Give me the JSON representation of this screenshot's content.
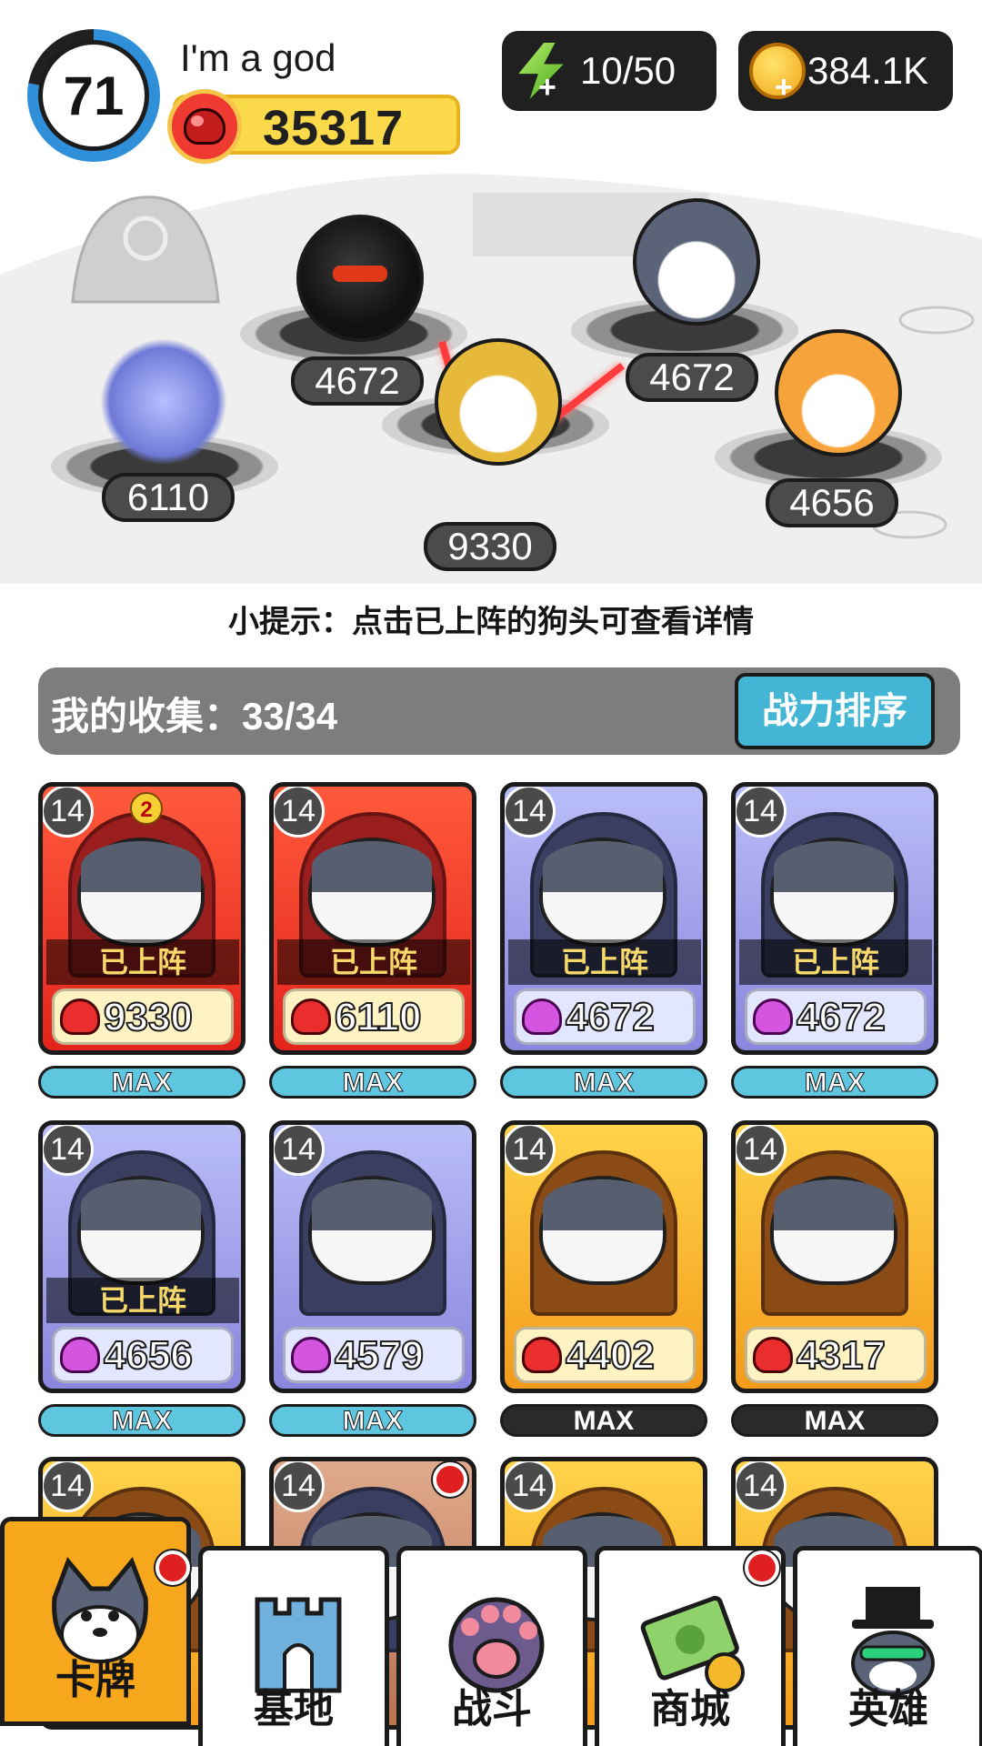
{
  "player": {
    "level": "71",
    "name": "I'm a god",
    "power": "35317"
  },
  "resources": {
    "energy": "10/50",
    "coins": "384.1K"
  },
  "arena": {
    "positions": [
      {
        "id": "left",
        "power": "6110"
      },
      {
        "id": "top-left",
        "power": "4672"
      },
      {
        "id": "center",
        "power": "9330"
      },
      {
        "id": "top-right",
        "power": "4672"
      },
      {
        "id": "right",
        "power": "4656"
      }
    ]
  },
  "tip": "小提示：点击已上阵的狗头可查看详情",
  "collection": {
    "label": "我的收集：33/34",
    "sort_button": "战力排序"
  },
  "cards": [
    {
      "level": "14",
      "stars": "2",
      "deployed": "已上阵",
      "power": "9330",
      "max": "MAX",
      "style": "red"
    },
    {
      "level": "14",
      "deployed": "已上阵",
      "power": "6110",
      "max": "MAX",
      "style": "red"
    },
    {
      "level": "14",
      "deployed": "已上阵",
      "power": "4672",
      "max": "MAX",
      "style": "purple"
    },
    {
      "level": "14",
      "deployed": "已上阵",
      "power": "4672",
      "max": "MAX",
      "style": "purple"
    },
    {
      "level": "14",
      "deployed": "已上阵",
      "power": "4656",
      "max": "MAX",
      "style": "purple"
    },
    {
      "level": "14",
      "power": "4579",
      "max": "MAX",
      "style": "purple"
    },
    {
      "level": "14",
      "power": "4402",
      "max": "MAX",
      "style": "gold"
    },
    {
      "level": "14",
      "power": "4317",
      "max": "MAX",
      "style": "gold"
    },
    {
      "level": "14",
      "style": "gold"
    },
    {
      "level": "14",
      "style": "bronze"
    },
    {
      "level": "14",
      "style": "gold"
    },
    {
      "level": "14",
      "style": "gold"
    }
  ],
  "nav": {
    "tabs": [
      {
        "label": "卡牌",
        "icon": "dog-card-icon",
        "active": true
      },
      {
        "label": "基地",
        "icon": "castle-icon"
      },
      {
        "label": "战斗",
        "icon": "paw-icon"
      },
      {
        "label": "商城",
        "icon": "money-icon"
      },
      {
        "label": "英雄",
        "icon": "hero-dog-icon"
      }
    ]
  },
  "colors": {
    "level_ring": "#2f8fd8",
    "power_pill": "#fad94a",
    "sort_button": "#43b6d6",
    "active_tab": "#f7a71c",
    "notification": "#e02020"
  }
}
